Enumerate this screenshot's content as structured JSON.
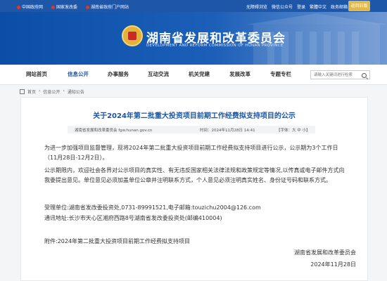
{
  "topbar": {
    "links": [
      "中国政府网",
      "国家发改委",
      "湖南省政府门户网站"
    ],
    "right": [
      "无障碍浏览",
      "微信公众号",
      "登录",
      "繁體中文",
      "政务邮箱"
    ],
    "old_version": "返回旧版"
  },
  "header": {
    "title": "湖南省发展和改革委员会",
    "subtitle": "DEVELOPMENT AND REFORM COMMISSION OF HUNAN PROVINCE"
  },
  "nav": {
    "items": [
      "网站首页",
      "信息公开",
      "办事服务",
      "互动交流",
      "机关党建",
      "发展改革",
      "专题专栏"
    ],
    "active": "信息公开",
    "search_placeholder": "请输入关键词进行检索"
  },
  "breadcrumb": [
    "首页",
    "信息公开",
    "通知公告"
  ],
  "article": {
    "title": "关于2024年第二批重大投资项目前期工作经费拟支持项目的公示",
    "source": "湖南省发展和改革委员会 fgw.hunan.gov.cn",
    "date": "时间：2024年11月28日 14:41",
    "font_size": "【字体：大 中 小】",
    "paragraph1": "为进一步加强项目监督管理，现将2024年第二批重大投资项目前期工作经费拟支持项目进行公示，公示期为3个工作日（11月28日-12月2日）。",
    "paragraph2": "公示期限内，欢迎社会各界对公示项目的真实性、有无违反国家相关法律法规和政策规定等情况,以传真或电子邮件方式向我委提出意见。单位意见必须加盖单位公章并注明联系方式，个人意见必须注明真实姓名、身份证号码和联系方式。",
    "contact1": "受理单位:湖南省发改委投资处,0731-89991521,电子邮箱:touzichu2004@126.com",
    "contact2": "通讯地址:长沙市天心区湘府西路8号湖南省发改委投资处(邮编410004)",
    "attachment": "附件:2024年第二批重大投资项目前期工作经费拟支持项目",
    "signature": "湖南省发展和改革委员会",
    "sign_date": "2024年11月28日"
  },
  "colors": {
    "brand_blue": "#1e56a8",
    "title_blue": "#1c55a3",
    "gold": "#e0b84d"
  }
}
